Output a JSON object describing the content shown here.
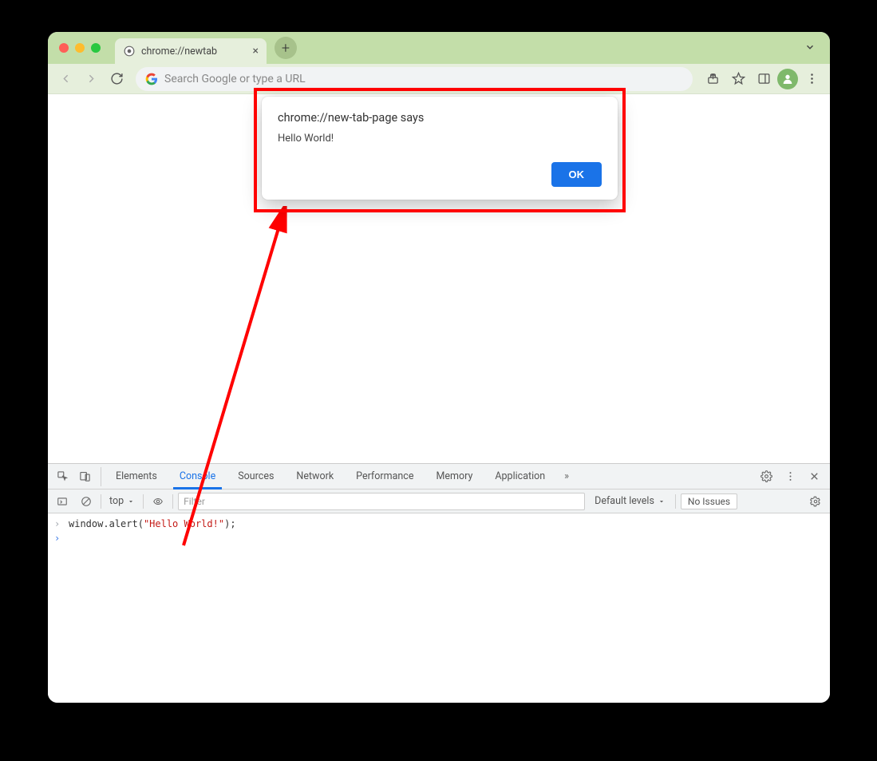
{
  "window": {
    "tab_title": "chrome://newtab",
    "omnibox_placeholder": "Search Google or type a URL"
  },
  "alert": {
    "title": "chrome://new-tab-page says",
    "message": "Hello World!",
    "ok_label": "OK"
  },
  "devtools": {
    "tabs": [
      "Elements",
      "Console",
      "Sources",
      "Network",
      "Performance",
      "Memory",
      "Application"
    ],
    "active_tab": "Console",
    "context": "top",
    "filter_placeholder": "Filter",
    "levels_label": "Default levels",
    "issues_label": "No Issues"
  },
  "console": {
    "call_fn": "window.alert",
    "call_open": "(",
    "call_arg": "\"Hello World!\"",
    "call_close": ");"
  }
}
